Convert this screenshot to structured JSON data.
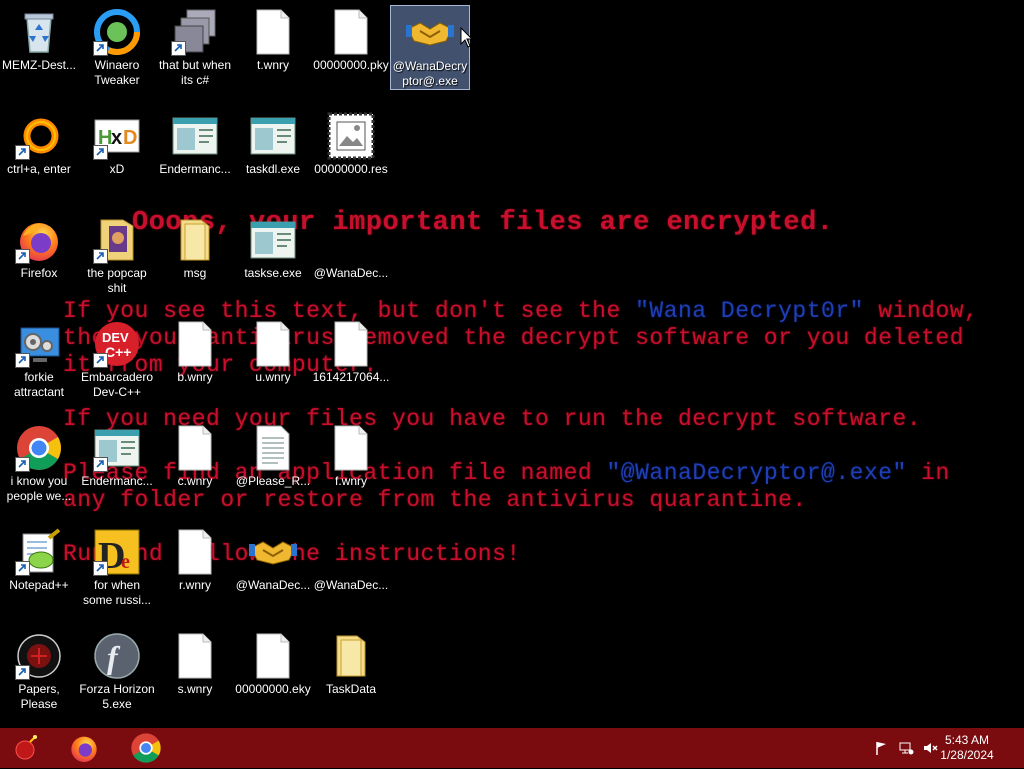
{
  "wallpaper": {
    "title": "Ooops, your important files are encrypted.",
    "line1_a": "If you see this text, but don't see the ",
    "line1_b": "\"Wana Decrypt0r\"",
    "line1_c": " window,",
    "line2": "then your antivirus removed the decrypt software or you deleted",
    "line3": "it from your computer.",
    "line4": "If you need your files you have to run the decrypt software.",
    "line5_a": "Please find an application file named ",
    "line5_b": "\"@WanaDecryptor@.exe\"",
    "line5_c": " in",
    "line6": "any folder or restore from the antivirus quarantine.",
    "line7": "Run and follow the instructions!"
  },
  "icons": [
    {
      "label": "MEMZ-Dest..."
    },
    {
      "label": "Winaero Tweaker"
    },
    {
      "label": "that but when its c#"
    },
    {
      "label": "t.wnry"
    },
    {
      "label": "00000000.pky"
    },
    {
      "label": "@WanaDecryptor@.exe"
    },
    {
      "label": "ctrl+a, enter"
    },
    {
      "label": "xD"
    },
    {
      "label": "Endermanc..."
    },
    {
      "label": "taskdl.exe"
    },
    {
      "label": "00000000.res"
    },
    {
      "label": "Firefox"
    },
    {
      "label": "the popcap shit"
    },
    {
      "label": "msg"
    },
    {
      "label": "taskse.exe"
    },
    {
      "label": "@WanaDec..."
    },
    {
      "label": "forkie attractant"
    },
    {
      "label": "Embarcadero Dev-C++"
    },
    {
      "label": "b.wnry"
    },
    {
      "label": "u.wnry"
    },
    {
      "label": "1614217064..."
    },
    {
      "label": "i know you people we..."
    },
    {
      "label": "Endermanc..."
    },
    {
      "label": "c.wnry"
    },
    {
      "label": "@Please_R..."
    },
    {
      "label": "f.wnry"
    },
    {
      "label": "Notepad++"
    },
    {
      "label": "for when some russi..."
    },
    {
      "label": "r.wnry"
    },
    {
      "label": "@WanaDec..."
    },
    {
      "label": "@WanaDec..."
    },
    {
      "label": "Papers, Please"
    },
    {
      "label": "Forza Horizon 5.exe"
    },
    {
      "label": "s.wnry"
    },
    {
      "label": "00000000.eky"
    },
    {
      "label": "TaskData"
    }
  ],
  "taskbar": {
    "start_icon": "bomb-icon",
    "pinned": [
      "firefox-icon",
      "chrome-icon"
    ],
    "tray": [
      "flag-icon",
      "network-icon",
      "volume-muted-icon"
    ],
    "time": "5:43 AM",
    "date": "1/28/2024",
    "color": "#7a0c10"
  }
}
